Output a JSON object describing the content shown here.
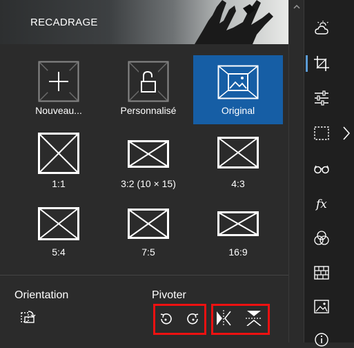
{
  "header": {
    "title": "RECADRAGE"
  },
  "presets": [
    {
      "label": "Nouveau...",
      "icon": "add-icon",
      "selected": false
    },
    {
      "label": "Personnalisé",
      "icon": "unlock-icon",
      "selected": false
    },
    {
      "label": "Original",
      "icon": "image-icon",
      "selected": true
    },
    {
      "label": "1:1",
      "icon": "ratio-1-1-icon",
      "selected": false
    },
    {
      "label": "3:2 (10 × 15)",
      "icon": "ratio-3-2-icon",
      "selected": false
    },
    {
      "label": "4:3",
      "icon": "ratio-4-3-icon",
      "selected": false
    },
    {
      "label": "5:4",
      "icon": "ratio-5-4-icon",
      "selected": false
    },
    {
      "label": "7:5",
      "icon": "ratio-7-5-icon",
      "selected": false
    },
    {
      "label": "16:9",
      "icon": "ratio-16-9-icon",
      "selected": false
    }
  ],
  "orientation": {
    "label": "Orientation",
    "icon": "swap-orientation-icon"
  },
  "rotate": {
    "label": "Pivoter",
    "icons": [
      "rotate-left-icon",
      "rotate-right-icon",
      "flip-horizontal-icon",
      "flip-vertical-icon"
    ]
  },
  "toolbar": {
    "icons": [
      "weather-icon",
      "crop-icon",
      "adjust-sliders-icon",
      "selection-icon",
      "glasses-icon",
      "fx-icon",
      "color-circles-icon",
      "frame-icon",
      "picture-icon",
      "info-icon"
    ],
    "active": "crop-icon",
    "fx_text": "fx"
  },
  "colors": {
    "accent": "#165ea5",
    "highlight": "#e11111",
    "background": "#2b2b2b"
  }
}
